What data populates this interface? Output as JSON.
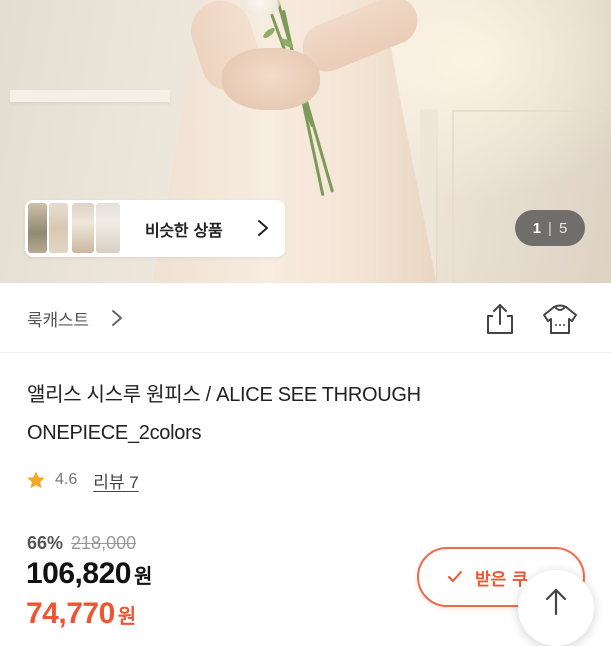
{
  "gallery": {
    "similar_label": "비슷한 상품",
    "page_current": "1",
    "page_separator": "|",
    "page_total": "5"
  },
  "brand": {
    "name": "룩캐스트"
  },
  "product": {
    "title_line1": "앨리스 시스루 원피스 / ALICE SEE THROUGH",
    "title_line2": "ONEPIECE_2colors",
    "rating": "4.6",
    "review_link": "리뷰 7",
    "discount_pct": "66%",
    "original_price": "218,000",
    "price": "106,820",
    "price_unit": "원",
    "coupon_price": "74,770",
    "coupon_unit": "원"
  },
  "coupon_button": {
    "label": "받은 쿠"
  },
  "colors": {
    "accent": "#ee5530",
    "star": "#f5a623",
    "text": "#222222",
    "muted": "#999999"
  },
  "icons": {
    "share": "share-icon",
    "wishlist": "hanger-icon",
    "star": "star-icon",
    "chevron": "chevron-right-icon",
    "scroll_top": "arrow-up-icon"
  }
}
